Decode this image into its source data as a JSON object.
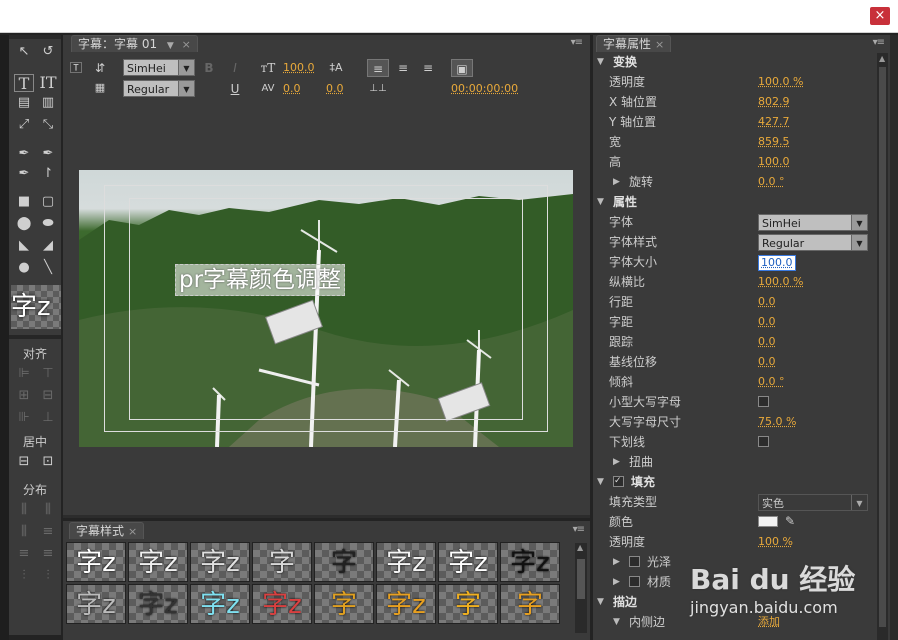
{
  "window": {
    "close_symbol": "×"
  },
  "tools": {
    "labels": {
      "align": "对齐",
      "center": "居中",
      "distribute": "分布"
    },
    "preview_glyph": "字z"
  },
  "editor": {
    "tab_label": "字幕：字幕 01",
    "font_family": "SimHei",
    "font_style": "Regular",
    "font_size": "100.0",
    "kerning": "0.0",
    "leading": "0.0",
    "timecode": "00:00:00:00",
    "caption_text": "pr字幕颜色调整",
    "icons": {
      "bold": "B",
      "italic": "I",
      "underline": "U"
    }
  },
  "styles": {
    "tab_label": "字幕样式",
    "swatches": [
      {
        "glyph": "字z",
        "color": "#ffffff"
      },
      {
        "glyph": "字z",
        "color": "#f0f0f0"
      },
      {
        "glyph": "字z",
        "color": "#e0e0e0"
      },
      {
        "glyph": "字",
        "color": "#d8d8d8"
      },
      {
        "glyph": "字",
        "color": "#222222"
      },
      {
        "glyph": "字z",
        "color": "#f5f5f5"
      },
      {
        "glyph": "字z",
        "color": "#ffffff"
      },
      {
        "glyph": "字z",
        "color": "#111111"
      },
      {
        "glyph": "字z",
        "color": "#bbbbbb"
      },
      {
        "glyph": "字z",
        "color": "#333333"
      },
      {
        "glyph": "字z",
        "color": "#7fe0f0"
      },
      {
        "glyph": "字z",
        "color": "#d94040"
      },
      {
        "glyph": "字",
        "color": "#e0a020"
      },
      {
        "glyph": "字z",
        "color": "#e8a020"
      },
      {
        "glyph": "字",
        "color": "#f0b020"
      },
      {
        "glyph": "字",
        "color": "#e8a020"
      }
    ]
  },
  "properties": {
    "tab_label": "字幕属性",
    "rows": [
      {
        "type": "section",
        "label": "变换"
      },
      {
        "type": "value",
        "label": "透明度",
        "value": "100.0 %"
      },
      {
        "type": "value",
        "label": "X 轴位置",
        "value": "802.9"
      },
      {
        "type": "value",
        "label": "Y 轴位置",
        "value": "427.7"
      },
      {
        "type": "value",
        "label": "宽",
        "value": "859.5"
      },
      {
        "type": "value",
        "label": "高",
        "value": "100.0"
      },
      {
        "type": "collapsed",
        "label": "旋转",
        "value": "0.0 °"
      },
      {
        "type": "section",
        "label": "属性"
      },
      {
        "type": "dropdown",
        "label": "字体",
        "value": "SimHei"
      },
      {
        "type": "dropdown",
        "label": "字体样式",
        "value": "Regular"
      },
      {
        "type": "selected",
        "label": "字体大小",
        "value": "100.0"
      },
      {
        "type": "value",
        "label": "纵横比",
        "value": "100.0 %"
      },
      {
        "type": "value",
        "label": "行距",
        "value": "0.0"
      },
      {
        "type": "value",
        "label": "字距",
        "value": "0.0"
      },
      {
        "type": "value",
        "label": "跟踪",
        "value": "0.0"
      },
      {
        "type": "value",
        "label": "基线位移",
        "value": "0.0"
      },
      {
        "type": "value",
        "label": "倾斜",
        "value": "0.0 °"
      },
      {
        "type": "checkbox",
        "label": "小型大写字母",
        "value": ""
      },
      {
        "type": "value",
        "label": "大写字母尺寸",
        "value": "75.0 %"
      },
      {
        "type": "checkbox",
        "label": "下划线",
        "value": ""
      },
      {
        "type": "collapsed",
        "label": "扭曲",
        "value": ""
      },
      {
        "type": "checksection",
        "label": "填充",
        "value": ""
      },
      {
        "type": "dropdown",
        "label": "填充类型",
        "value": "实色"
      },
      {
        "type": "color",
        "label": "颜色",
        "value": ""
      },
      {
        "type": "value",
        "label": "透明度",
        "value": "100 %"
      },
      {
        "type": "subcheck",
        "label": "光泽",
        "value": ""
      },
      {
        "type": "subcheck",
        "label": "材质",
        "value": ""
      },
      {
        "type": "section",
        "label": "描边"
      },
      {
        "type": "sub",
        "label": "内侧边",
        "value": "添加"
      }
    ]
  },
  "watermark": {
    "brand": "Bai du 经验",
    "url": "jingyan.baidu.com"
  }
}
